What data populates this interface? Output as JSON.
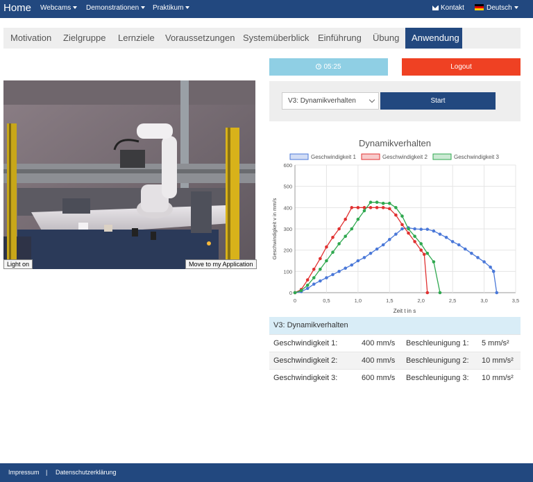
{
  "navbar": {
    "brand": "Home",
    "items": [
      "Webcams",
      "Demonstrationen",
      "Praktikum"
    ],
    "contact": "Kontakt",
    "language": "Deutsch"
  },
  "tabs": [
    {
      "label": "Motivation",
      "active": false
    },
    {
      "label": "Zielgruppe",
      "active": false
    },
    {
      "label": "Lernziele",
      "active": false
    },
    {
      "label": "Voraussetzungen",
      "active": false
    },
    {
      "label": "Systemüberblick",
      "active": false
    },
    {
      "label": "Einführung",
      "active": false
    },
    {
      "label": "Übung",
      "active": false
    },
    {
      "label": "Anwendung",
      "active": true
    }
  ],
  "webcam": {
    "light_button": "Light on",
    "move_button": "Move to my Application"
  },
  "timer": {
    "value": "05:25",
    "icon": "clock-icon"
  },
  "logout_label": "Logout",
  "experiment": {
    "selected": "V3: Dynamikverhalten",
    "start_label": "Start"
  },
  "chart_data": {
    "type": "line",
    "title": "Dynamikverhalten",
    "xlabel": "Zeit t in s",
    "ylabel": "Geschwindigkeit v in mm/s",
    "xlim": [
      0,
      3.5
    ],
    "ylim": [
      0,
      600
    ],
    "xticks": [
      "0",
      "0,5",
      "1,0",
      "1,5",
      "2,0",
      "2,5",
      "3,0",
      "3,5"
    ],
    "yticks": [
      "0",
      "100",
      "200",
      "300",
      "400",
      "500",
      "600"
    ],
    "grid": true,
    "legend": "top",
    "series": [
      {
        "name": "Geschwindigkeit 1",
        "color": "#4a78d8",
        "points": [
          [
            0,
            0
          ],
          [
            0.1,
            5
          ],
          [
            0.2,
            20
          ],
          [
            0.3,
            40
          ],
          [
            0.4,
            55
          ],
          [
            0.5,
            70
          ],
          [
            0.6,
            85
          ],
          [
            0.7,
            100
          ],
          [
            0.8,
            115
          ],
          [
            0.9,
            130
          ],
          [
            1.0,
            150
          ],
          [
            1.1,
            165
          ],
          [
            1.2,
            185
          ],
          [
            1.3,
            205
          ],
          [
            1.4,
            225
          ],
          [
            1.5,
            250
          ],
          [
            1.6,
            275
          ],
          [
            1.7,
            300
          ],
          [
            1.8,
            305
          ],
          [
            1.9,
            300
          ],
          [
            2.0,
            298
          ],
          [
            2.1,
            298
          ],
          [
            2.2,
            290
          ],
          [
            2.3,
            275
          ],
          [
            2.4,
            260
          ],
          [
            2.5,
            240
          ],
          [
            2.6,
            225
          ],
          [
            2.7,
            205
          ],
          [
            2.8,
            185
          ],
          [
            2.9,
            165
          ],
          [
            3.0,
            145
          ],
          [
            3.1,
            120
          ],
          [
            3.15,
            100
          ],
          [
            3.2,
            0
          ]
        ]
      },
      {
        "name": "Geschwindigkeit 2",
        "color": "#e03131",
        "points": [
          [
            0,
            0
          ],
          [
            0.1,
            15
          ],
          [
            0.2,
            60
          ],
          [
            0.3,
            110
          ],
          [
            0.4,
            160
          ],
          [
            0.5,
            215
          ],
          [
            0.6,
            260
          ],
          [
            0.7,
            300
          ],
          [
            0.8,
            345
          ],
          [
            0.9,
            400
          ],
          [
            1.0,
            400
          ],
          [
            1.1,
            400
          ],
          [
            1.2,
            400
          ],
          [
            1.3,
            400
          ],
          [
            1.4,
            400
          ],
          [
            1.5,
            395
          ],
          [
            1.6,
            365
          ],
          [
            1.7,
            320
          ],
          [
            1.8,
            280
          ],
          [
            1.9,
            240
          ],
          [
            2.0,
            200
          ],
          [
            2.05,
            180
          ],
          [
            2.1,
            0
          ]
        ]
      },
      {
        "name": "Geschwindigkeit 3",
        "color": "#2fa84f",
        "points": [
          [
            0,
            0
          ],
          [
            0.1,
            10
          ],
          [
            0.2,
            35
          ],
          [
            0.3,
            70
          ],
          [
            0.4,
            110
          ],
          [
            0.5,
            150
          ],
          [
            0.6,
            190
          ],
          [
            0.7,
            230
          ],
          [
            0.8,
            265
          ],
          [
            0.9,
            300
          ],
          [
            1.0,
            345
          ],
          [
            1.1,
            385
          ],
          [
            1.2,
            425
          ],
          [
            1.3,
            425
          ],
          [
            1.4,
            420
          ],
          [
            1.5,
            420
          ],
          [
            1.6,
            400
          ],
          [
            1.7,
            360
          ],
          [
            1.8,
            300
          ],
          [
            1.9,
            265
          ],
          [
            2.0,
            230
          ],
          [
            2.1,
            185
          ],
          [
            2.2,
            145
          ],
          [
            2.3,
            0
          ]
        ]
      }
    ]
  },
  "params": {
    "heading": "V3: Dynamikverhalten",
    "rows": [
      {
        "speed_label": "Geschwindigkeit 1:",
        "speed": "400 mm/s",
        "accel_label": "Beschleunigung 1:",
        "accel": "5 mm/s²"
      },
      {
        "speed_label": "Geschwindigkeit 2:",
        "speed": "400 mm/s",
        "accel_label": "Beschleunigung 2:",
        "accel": "10 mm/s²"
      },
      {
        "speed_label": "Geschwindigkeit 3:",
        "speed": "600 mm/s",
        "accel_label": "Beschleunigung 3:",
        "accel": "10 mm/s²"
      }
    ]
  },
  "footer": {
    "impressum": "Impressum",
    "separator": "|",
    "privacy": "Datenschutzerklärung"
  }
}
